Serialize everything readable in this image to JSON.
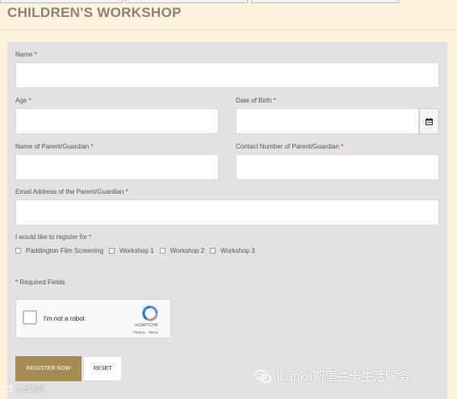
{
  "title": "CHILDREN'S WORKSHOP",
  "required_mark": "*",
  "fields": {
    "name": "Name",
    "age": "Age",
    "dob": "Date of Birth",
    "parent_name": "Name of Parent/Guardian",
    "contact": "Contact Number of Parent/Guardian",
    "email": "Email Address of the Parent/Guardian"
  },
  "register_for": {
    "label": "I would like to register for",
    "options": [
      "Paddington Film Screening",
      "Workshop 1",
      "Workshop 2",
      "Workshop 3"
    ]
  },
  "required_note": "Required Fields",
  "recaptcha": {
    "label": "I'm not a robot",
    "brand": "reCAPTCHA",
    "links": "Privacy - Terms"
  },
  "buttons": {
    "register": "REGISTER NOW",
    "reset": "RESET"
  },
  "watermark": {
    "main": "iLanka斯里兰卡生活服务",
    "small": "大战游戏"
  },
  "colors": {
    "page_bg": "#fbf3dc",
    "form_bg": "#e2e2e4",
    "accent": "#a38b52",
    "required": "#cc2222"
  },
  "icons": [
    "calendar-icon",
    "recaptcha-logo-icon",
    "wechat-icon",
    "weibo-icon"
  ]
}
